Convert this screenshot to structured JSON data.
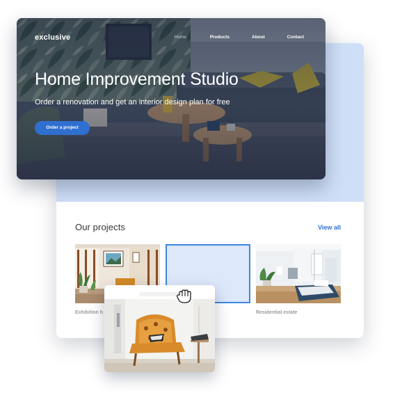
{
  "hero": {
    "brand": "exclusive",
    "nav": [
      "Home",
      "Products",
      "About",
      "Contact"
    ],
    "headline": "Home Improvement Studio",
    "subline": "Order a renovation and get an interior design plan for free",
    "cta_label": "Order a project"
  },
  "projects": {
    "title": "Our projects",
    "view_all": "View all",
    "items": [
      {
        "caption": "Exhibition h"
      },
      {
        "caption": ""
      },
      {
        "caption": "Residential estate"
      }
    ]
  },
  "drag": {
    "cursor_icon": "grab-hand-icon"
  },
  "colors": {
    "accent": "#2f6fd0",
    "link": "#2f72d7",
    "band": "#cfdff7",
    "drop_target_border": "#3d86e0"
  }
}
